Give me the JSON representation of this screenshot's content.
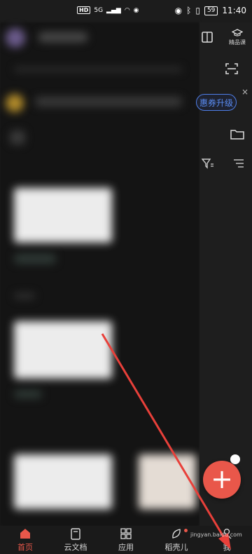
{
  "status_bar": {
    "hd": "HD",
    "network": "5G",
    "battery": "59",
    "time": "11:40"
  },
  "header": {
    "premium_label": "精品课"
  },
  "banner": {
    "upgrade_label": "惠券升级",
    "close_label": "×"
  },
  "fab": {
    "label": "+"
  },
  "bottom_nav": {
    "items": [
      {
        "label": "首页",
        "icon": "home-icon",
        "active": true
      },
      {
        "label": "云文档",
        "icon": "document-icon",
        "active": false
      },
      {
        "label": "应用",
        "icon": "apps-grid-icon",
        "active": false
      },
      {
        "label": "稻壳儿",
        "icon": "leaf-icon",
        "active": false
      },
      {
        "label": "我",
        "icon": "profile-icon",
        "active": false
      }
    ]
  },
  "watermark": "jingyan.baidu.com",
  "colors": {
    "accent": "#e9574a",
    "link_blue": "#5a8bf0",
    "background": "#1c1c1c"
  }
}
